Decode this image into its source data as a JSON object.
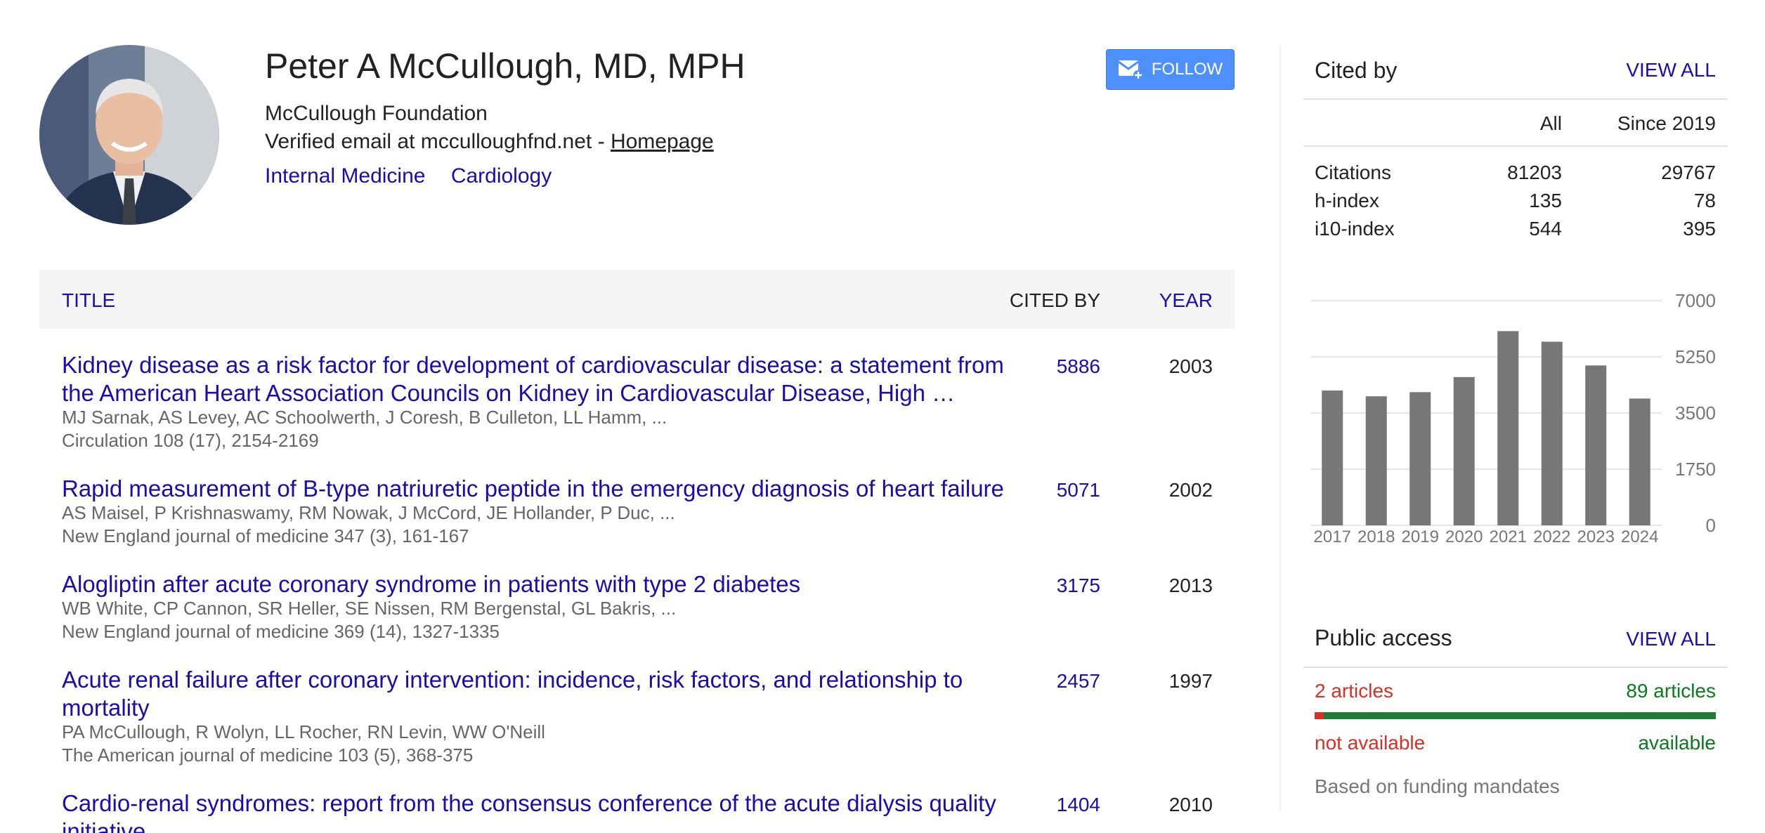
{
  "profile": {
    "name": "Peter A McCullough, MD, MPH",
    "affiliation": "McCullough Foundation",
    "email_prefix": "Verified email at mcculloughfnd.net - ",
    "homepage_label": "Homepage",
    "interests": [
      "Internal Medicine",
      "Cardiology"
    ],
    "follow_label": "FOLLOW"
  },
  "table": {
    "col_title": "TITLE",
    "col_cited": "CITED BY",
    "col_year": "YEAR",
    "rows": [
      {
        "title": "Kidney disease as a risk factor for development of cardiovascular disease: a statement from the American Heart Association Councils on Kidney in Cardiovascular Disease, High …",
        "authors": "MJ Sarnak, AS Levey, AC Schoolwerth, J Coresh, B Culleton, LL Hamm, ...",
        "venue": "Circulation 108 (17), 2154-2169",
        "cited": "5886",
        "year": "2003"
      },
      {
        "title": "Rapid measurement of B-type natriuretic peptide in the emergency diagnosis of heart failure",
        "authors": "AS Maisel, P Krishnaswamy, RM Nowak, J McCord, JE Hollander, P Duc, ...",
        "venue": "New England journal of medicine 347 (3), 161-167",
        "cited": "5071",
        "year": "2002"
      },
      {
        "title": "Alogliptin after acute coronary syndrome in patients with type 2 diabetes",
        "authors": "WB White, CP Cannon, SR Heller, SE Nissen, RM Bergenstal, GL Bakris, ...",
        "venue": "New England journal of medicine 369 (14), 1327-1335",
        "cited": "3175",
        "year": "2013"
      },
      {
        "title": "Acute renal failure after coronary intervention: incidence, risk factors, and relationship to mortality",
        "authors": "PA McCullough, R Wolyn, LL Rocher, RN Levin, WW O'Neill",
        "venue": "The American journal of medicine 103 (5), 368-375",
        "cited": "2457",
        "year": "1997"
      },
      {
        "title": "Cardio-renal syndromes: report from the consensus conference of the acute dialysis quality initiative",
        "authors": "",
        "venue": "",
        "cited": "1404",
        "year": "2010"
      }
    ]
  },
  "cited_by": {
    "title": "Cited by",
    "view_all": "VIEW ALL",
    "col_all": "All",
    "col_since": "Since 2019",
    "stats": [
      {
        "label": "Citations",
        "all": "81203",
        "since": "29767"
      },
      {
        "label": "h-index",
        "all": "135",
        "since": "78"
      },
      {
        "label": "i10-index",
        "all": "544",
        "since": "395"
      }
    ]
  },
  "chart_data": {
    "type": "bar",
    "categories": [
      "2017",
      "2018",
      "2019",
      "2020",
      "2021",
      "2022",
      "2023",
      "2024"
    ],
    "values": [
      4200,
      4020,
      4150,
      4620,
      6050,
      5720,
      4980,
      3950
    ],
    "ylim": [
      0,
      7000
    ],
    "yticks": [
      "0",
      "1750",
      "3500",
      "5250",
      "7000"
    ],
    "bar_color": "#777777",
    "grid": true
  },
  "public_access": {
    "title": "Public access",
    "view_all": "VIEW ALL",
    "not_available_count": "2 articles",
    "available_count": "89 articles",
    "not_available_label": "not available",
    "available_label": "available",
    "not_available_fraction": 0.022,
    "note": "Based on funding mandates",
    "colors": {
      "not_available": "#d93025",
      "available": "#1e7a36"
    }
  }
}
